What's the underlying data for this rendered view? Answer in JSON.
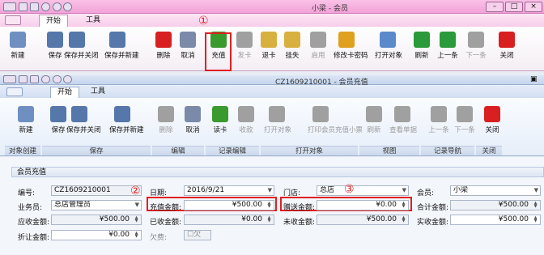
{
  "outer": {
    "title": "小梁 - 会员",
    "tabs": [
      "开始",
      "工具"
    ],
    "buttons": [
      {
        "label": "新建",
        "icon": "new-doc-icon",
        "color": "#6f8fc0"
      },
      {
        "label": "保存",
        "icon": "save-icon",
        "color": "#5577aa"
      },
      {
        "label": "保存并关闭",
        "icon": "save-close-icon",
        "color": "#5577aa"
      },
      {
        "label": "保存并新建",
        "icon": "save-new-icon",
        "color": "#5577aa"
      },
      {
        "label": "删除",
        "icon": "delete-x-icon",
        "color": "#d82020"
      },
      {
        "label": "取消",
        "icon": "undo-icon",
        "color": "#7a8aa8"
      },
      {
        "label": "充值",
        "icon": "recharge-icon",
        "color": "#3a9a2e"
      },
      {
        "label": "发卡",
        "icon": "issue-card-icon",
        "color": "#a0a0a0"
      },
      {
        "label": "退卡",
        "icon": "return-card-icon",
        "color": "#d8b040"
      },
      {
        "label": "挂失",
        "icon": "report-loss-icon",
        "color": "#d8b040"
      },
      {
        "label": "启用",
        "icon": "enable-icon",
        "color": "#a0a0a0"
      },
      {
        "label": "修改卡密码",
        "icon": "key-icon",
        "color": "#e0a020"
      },
      {
        "label": "打开对象",
        "icon": "open-object-icon",
        "color": "#5b8acb"
      },
      {
        "label": "刷新",
        "icon": "refresh-icon",
        "color": "#2a9a3a"
      },
      {
        "label": "上一条",
        "icon": "prev-up-icon",
        "color": "#2a9a3a"
      },
      {
        "label": "下一条",
        "icon": "next-down-icon",
        "color": "#a0a0a0"
      },
      {
        "label": "关闭",
        "icon": "close-x-icon",
        "color": "#d82020"
      }
    ]
  },
  "inner": {
    "title": "CZ1609210001 - 会员充值",
    "tabs": [
      "开始",
      "工具"
    ],
    "buttons": [
      {
        "label": "新建",
        "icon": "new-doc-icon",
        "color": "#6f8fc0"
      },
      {
        "label": "保存",
        "icon": "save-icon",
        "color": "#5577aa"
      },
      {
        "label": "保存并关闭",
        "icon": "save-close-icon",
        "color": "#5577aa"
      },
      {
        "label": "保存并新建",
        "icon": "save-new-icon",
        "color": "#5577aa"
      },
      {
        "label": "删除",
        "icon": "delete-x-icon",
        "color": "#a0a0a0"
      },
      {
        "label": "取消",
        "icon": "undo-icon",
        "color": "#7a8aa8"
      },
      {
        "label": "读卡",
        "icon": "read-card-icon",
        "color": "#3a9a2e"
      },
      {
        "label": "收款",
        "icon": "receive-icon",
        "color": "#a0a0a0"
      },
      {
        "label": "打开对象",
        "icon": "open-object-icon",
        "color": "#a0a0a0"
      },
      {
        "label": "打印会员充值小票",
        "icon": "print-icon",
        "color": "#a0a0a0"
      },
      {
        "label": "刷新",
        "icon": "refresh-icon",
        "color": "#a0a0a0"
      },
      {
        "label": "查看单据",
        "icon": "view-doc-icon",
        "color": "#a0a0a0"
      },
      {
        "label": "上一条",
        "icon": "prev-up-icon",
        "color": "#a0a0a0"
      },
      {
        "label": "下一条",
        "icon": "next-down-icon",
        "color": "#a0a0a0"
      },
      {
        "label": "关闭",
        "icon": "close-x-icon",
        "color": "#d82020"
      }
    ],
    "groups": [
      "对象创建",
      "保存",
      "编辑",
      "记录编辑",
      "打开对象",
      "视图",
      "记录导航",
      "关闭"
    ]
  },
  "form": {
    "panel_title": "会员充值",
    "labels": {
      "code": "编号:",
      "date": "日期:",
      "store": "门店:",
      "member": "会员:",
      "salesperson": "业务员:",
      "recharge_amount": "充值金额:",
      "gift_amount": "赠送金额:",
      "total_amount": "合计金额:",
      "receivable": "应收金额:",
      "received": "已收金额:",
      "uncollected": "未收金额:",
      "actual_received": "实收金额:",
      "discount": "折让金额:",
      "owed": "欠费:"
    },
    "values": {
      "code": "CZ1609210001",
      "date": "2016/9/21",
      "store": "总店",
      "member": "小梁",
      "salesperson": "总店管理员",
      "recharge_amount": "¥500.00",
      "gift_amount": "¥0.00",
      "total_amount": "¥500.00",
      "receivable": "¥500.00",
      "received": "¥0.00",
      "uncollected": "¥500.00",
      "actual_received": "¥500.00",
      "discount": "¥0.00",
      "owed": "欠"
    }
  },
  "annotations": [
    "①",
    "②",
    "③"
  ]
}
